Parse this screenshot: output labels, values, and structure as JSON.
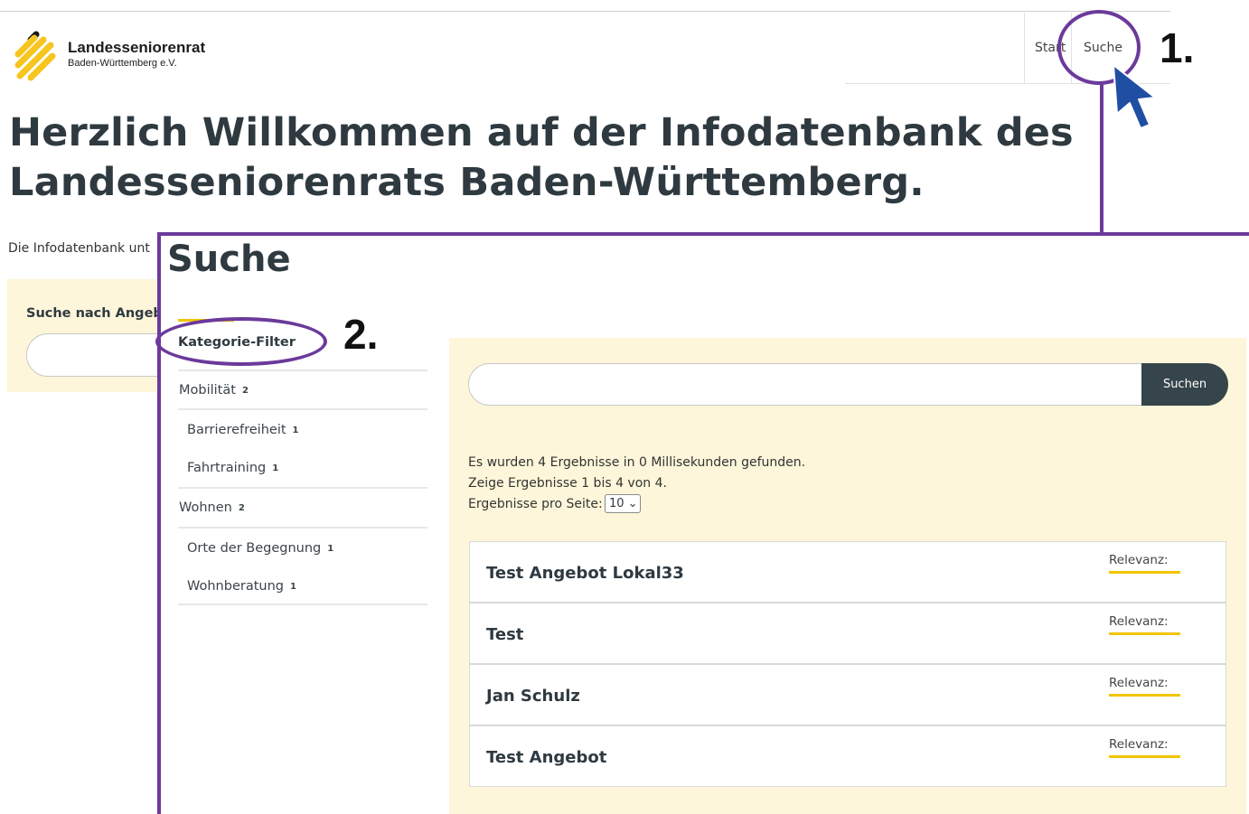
{
  "site": {
    "brand_name": "Landesseniorenrat",
    "brand_sub": "Baden-Württemberg e.V.",
    "nav": {
      "start": "Start",
      "suche": "Suche"
    }
  },
  "hero": {
    "title": "Herzlich Willkommen auf der Infodatenbank des Landesseniorenrats Baden-Württemberg.",
    "intro": "Die Infodatenbank unt",
    "search_label": "Suche nach Angeb"
  },
  "search_page": {
    "title": "Suche",
    "filter_heading": "Kategorie-Filter",
    "filters": [
      {
        "label": "Mobilität",
        "count": "2"
      },
      {
        "label": "Barrierefreiheit",
        "count": "1"
      },
      {
        "label": "Fahrtraining",
        "count": "1"
      },
      {
        "label": "Wohnen",
        "count": "2"
      },
      {
        "label": "Orte der Begegnung",
        "count": "1"
      },
      {
        "label": "Wohnberatung",
        "count": "1"
      }
    ],
    "search_button": "Suchen",
    "search_value": "",
    "info_found": "Es wurden 4 Ergebnisse in 0 Millisekunden gefunden.",
    "info_showing": "Zeige Ergebnisse 1 bis 4 von 4.",
    "per_page_label": "Ergebnisse pro Seite:",
    "per_page_value": "10 ⌄",
    "relevanz_label": "Relevanz:",
    "results": [
      {
        "title": "Test Angebot Lokal33"
      },
      {
        "title": "Test"
      },
      {
        "title": "Jan Schulz"
      },
      {
        "title": "Test Angebot"
      }
    ]
  },
  "annotations": {
    "step1": "1.",
    "step2": "2."
  },
  "colors": {
    "accent_purple": "#6b3a9b",
    "yellow": "#f2c500",
    "panel": "#fdf6da",
    "dark": "#36454c",
    "cursor": "#1f4ea3"
  },
  "icons": {
    "logo": "logo-icon",
    "cursor": "cursor-arrow-icon",
    "dropdown": "chevron-down-icon"
  }
}
